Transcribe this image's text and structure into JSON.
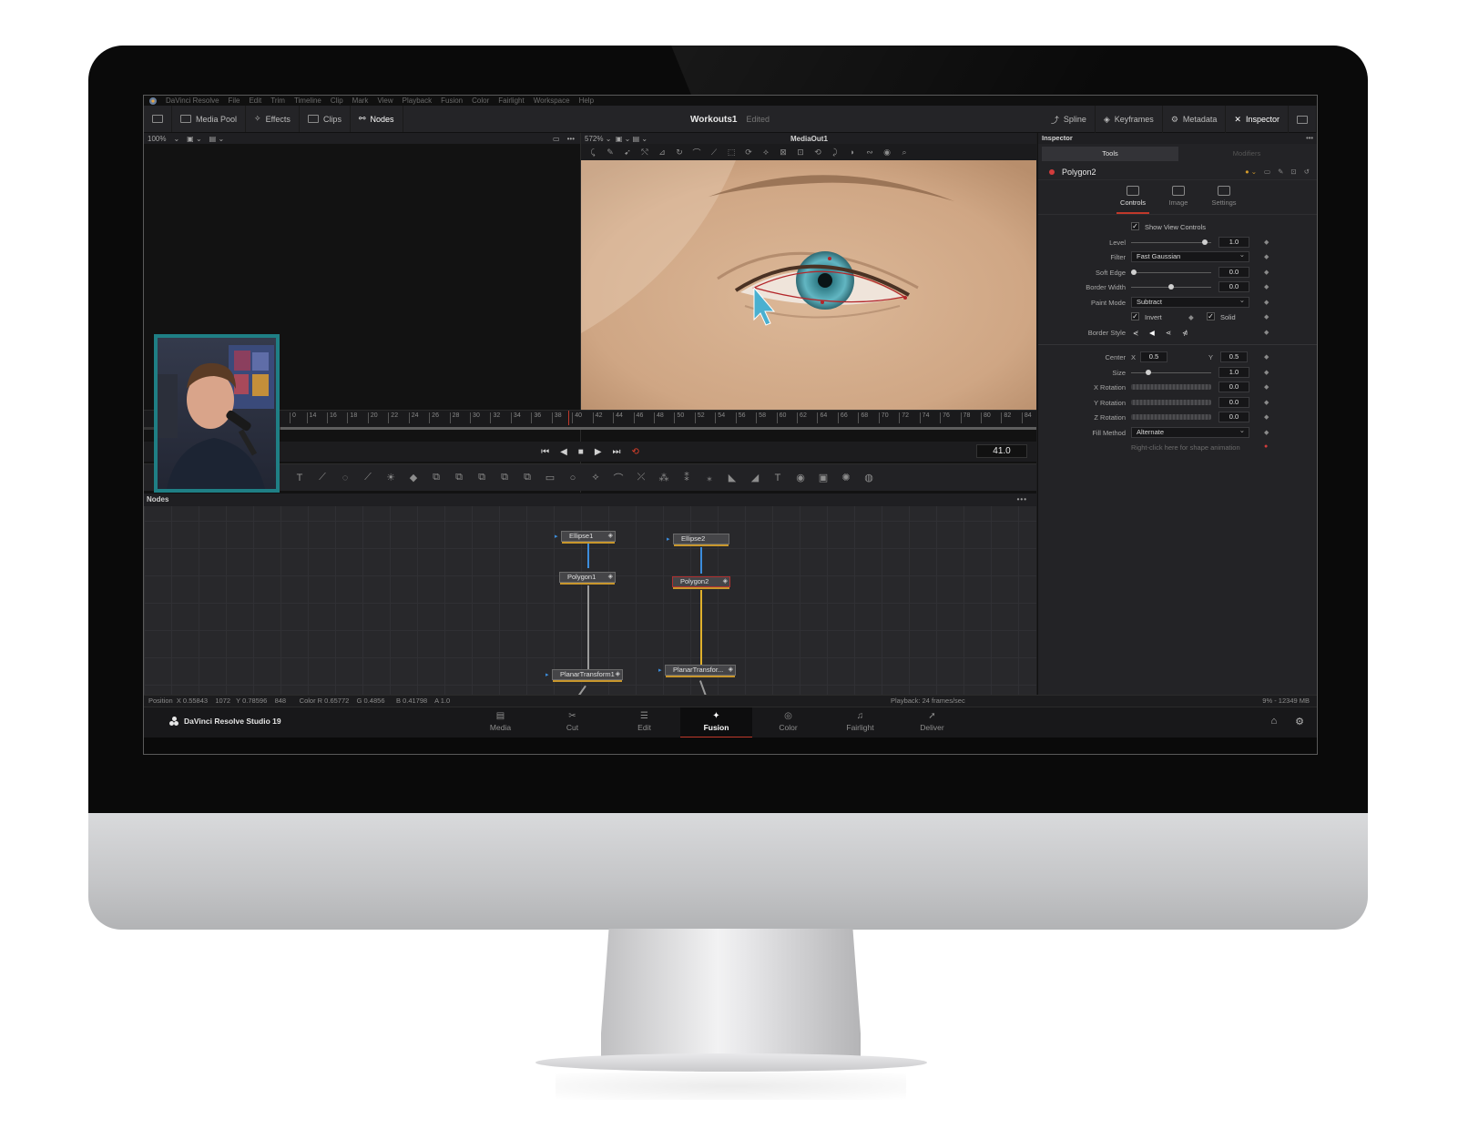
{
  "app": {
    "name": "DaVinci Resolve",
    "brand": "DaVinci Resolve Studio 19",
    "menu": [
      "DaVinci Resolve",
      "File",
      "Edit",
      "Trim",
      "Timeline",
      "Clip",
      "Mark",
      "View",
      "Playback",
      "Fusion",
      "Color",
      "Fairlight",
      "Workspace",
      "Help"
    ]
  },
  "toolbar": {
    "left": [
      "Media Pool",
      "Effects",
      "Clips",
      "Nodes"
    ],
    "project_name": "Workouts1",
    "project_state": "Edited",
    "right": [
      "Spline",
      "Keyframes",
      "Metadata",
      "Inspector"
    ]
  },
  "viewer_left": {
    "zoom": "100%"
  },
  "viewer_right": {
    "zoom": "572%",
    "clip": "MediaOut1"
  },
  "timeline": {
    "ticks": [
      "0",
      "14",
      "16",
      "18",
      "20",
      "22",
      "24",
      "26",
      "28",
      "30",
      "32",
      "34",
      "36",
      "38",
      "40",
      "42",
      "44",
      "46",
      "48",
      "50",
      "52",
      "54",
      "56",
      "58",
      "60",
      "62",
      "64",
      "66",
      "68",
      "70",
      "72",
      "74",
      "76",
      "78",
      "80",
      "82",
      "84"
    ],
    "current_frame": "41.0"
  },
  "nodes_panel": {
    "title": "Nodes",
    "more": "•••",
    "nodes": [
      {
        "name": "Ellipse1"
      },
      {
        "name": "Polygon1"
      },
      {
        "name": "PlanarTransform1"
      },
      {
        "name": "Ellipse2"
      },
      {
        "name": "Polygon2",
        "selected": true
      },
      {
        "name": "PlanarTransfor..."
      }
    ]
  },
  "inspector": {
    "title": "Inspector",
    "tabs": [
      "Tools",
      "Modifiers"
    ],
    "tool_name": "Polygon2",
    "subtabs": [
      "Controls",
      "Image",
      "Settings"
    ],
    "show_view_controls": "Show View Controls",
    "props": {
      "level": {
        "label": "Level",
        "value": "1.0",
        "fill": 0.95
      },
      "filter": {
        "label": "Filter",
        "value": "Fast Gaussian"
      },
      "soft_edge": {
        "label": "Soft Edge",
        "value": "0.0",
        "fill": 0.0
      },
      "border_width": {
        "label": "Border Width",
        "value": "0.0",
        "fill": 0.5
      },
      "paint_mode": {
        "label": "Paint Mode",
        "value": "Subtract"
      },
      "invert": "Invert",
      "solid": "Solid",
      "border_style": {
        "label": "Border Style"
      },
      "center": {
        "label": "Center",
        "x_label": "X",
        "x": "0.5",
        "y_label": "Y",
        "y": "0.5"
      },
      "size": {
        "label": "Size",
        "value": "1.0",
        "fill": 0.2
      },
      "x_rotation": {
        "label": "X Rotation",
        "value": "0.0"
      },
      "y_rotation": {
        "label": "Y Rotation",
        "value": "0.0"
      },
      "z_rotation": {
        "label": "Z Rotation",
        "value": "0.0"
      },
      "fill_method": {
        "label": "Fill Method",
        "value": "Alternate"
      },
      "hint": "Right-click here for shape animation"
    }
  },
  "statusbar": {
    "left": "Position  X 0.55843    1072   Y 0.78596    848       Color R 0.65772    G 0.4856      B 0.41798    A 1.0",
    "playback": "Playback: 24 frames/sec",
    "memory": "9% - 12349 MB"
  },
  "pages": [
    "Media",
    "Cut",
    "Edit",
    "Fusion",
    "Color",
    "Fairlight",
    "Deliver"
  ],
  "active_page": "Fusion",
  "colors": {
    "accent_red": "#c0392b",
    "node_wire_blue": "#3c8ddc",
    "node_wire_yellow": "#e1b12c",
    "pip_border": "#1f7f85"
  }
}
